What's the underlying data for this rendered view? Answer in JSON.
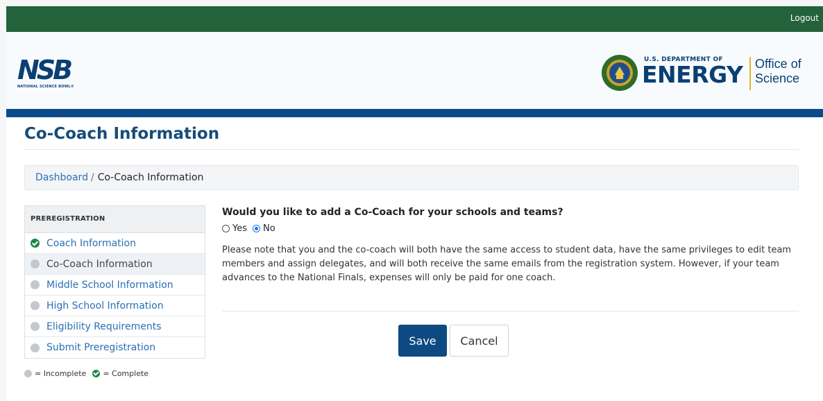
{
  "topbar": {
    "logout_label": "Logout"
  },
  "header": {
    "nsb_logo_text": "NSB",
    "nsb_logo_subtext": "NATIONAL SCIENCE BOWL®",
    "doe_small": "U.S. DEPARTMENT OF",
    "doe_big": "ENERGY",
    "office_line1": "Office of",
    "office_line2": "Science"
  },
  "page": {
    "title": "Co-Coach Information"
  },
  "breadcrumb": {
    "home": "Dashboard",
    "separator": "/",
    "current": "Co-Coach Information"
  },
  "sidebar": {
    "heading": "PREREGISTRATION",
    "items": [
      {
        "label": "Coach Information",
        "status": "complete"
      },
      {
        "label": "Co-Coach Information",
        "status": "incomplete"
      },
      {
        "label": "Middle School Information",
        "status": "incomplete"
      },
      {
        "label": "High School Information",
        "status": "incomplete"
      },
      {
        "label": "Eligibility Requirements",
        "status": "incomplete"
      },
      {
        "label": "Submit Preregistration",
        "status": "incomplete"
      }
    ]
  },
  "legend": {
    "incomplete": "= Incomplete",
    "complete": "= Complete"
  },
  "form": {
    "question": "Would you like to add a Co-Coach for your schools and teams?",
    "option_yes": "Yes",
    "option_no": "No",
    "selected": "No",
    "note": "Please note that you and the co-coach will both have the same access to student data, have the same privileges to edit team members and assign delegates, and will both receive the same emails from the registration system. However, if your team advances to the National Finals, expenses will only be paid for one coach.",
    "save_label": "Save",
    "cancel_label": "Cancel"
  },
  "colors": {
    "topbar": "#23623a",
    "brand_blue": "#0b4a8b",
    "complete_green": "#19874a",
    "incomplete_gray": "#c4c7cb"
  }
}
